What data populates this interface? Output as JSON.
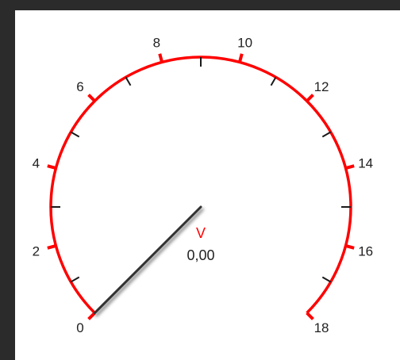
{
  "gauge": {
    "unit": "V",
    "value_text": "0,00",
    "value": 0,
    "min": 0,
    "max": 18,
    "major_step": 2,
    "minor_step": 1,
    "sweep_degrees": 270,
    "major_labels": [
      "0",
      "2",
      "4",
      "6",
      "8",
      "10",
      "12",
      "14",
      "16",
      "18"
    ],
    "colors": {
      "scale": "#ff0000",
      "major_tick": "#ff0000",
      "minor_tick": "#1a1a1a",
      "needle": "#333333",
      "unit": "#ff0000",
      "background": "#ffffff",
      "frame": "#2b2b2b"
    }
  }
}
